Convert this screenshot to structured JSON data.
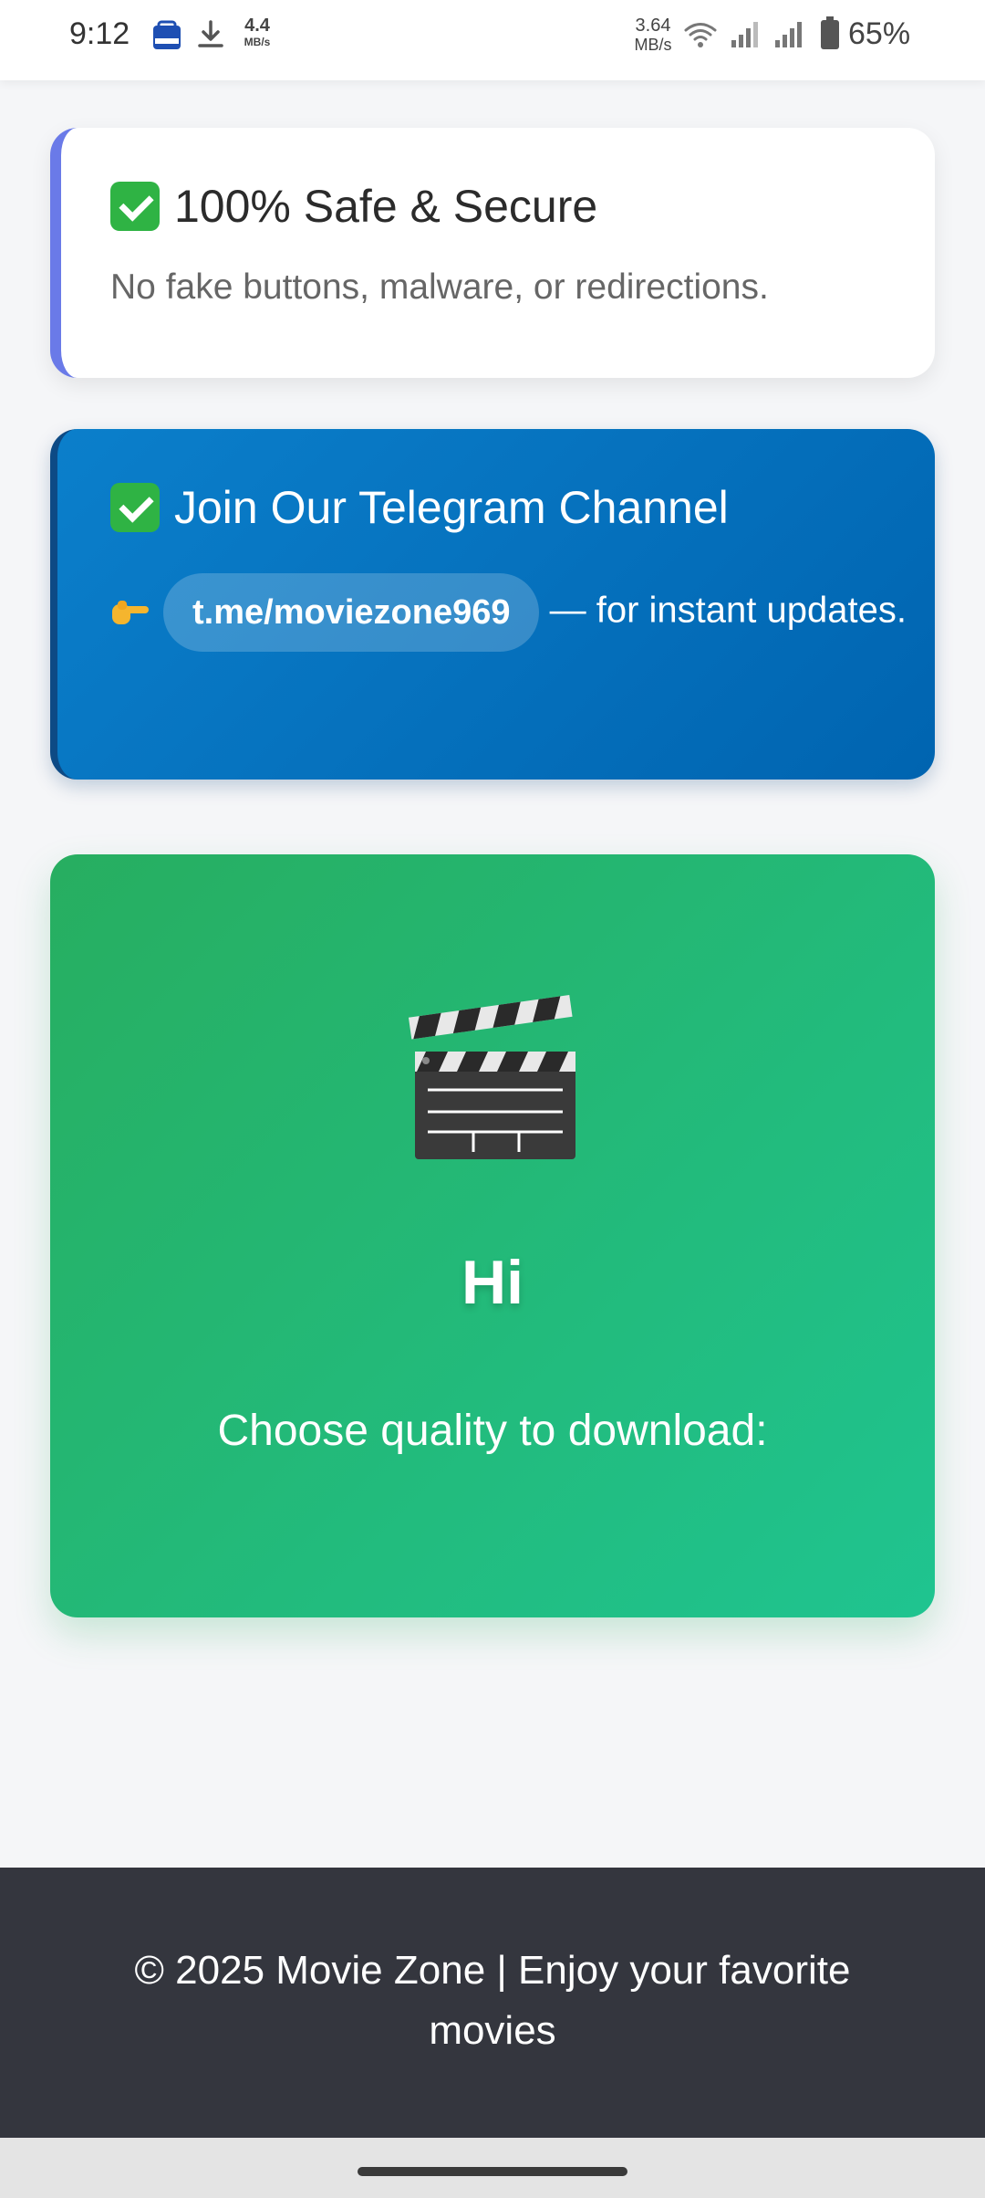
{
  "status_bar": {
    "time": "9:12",
    "speed_left_value": "4.4",
    "speed_left_unit": "MB/s",
    "speed_right_value": "3.64",
    "speed_right_unit": "MB/s",
    "battery": "65%"
  },
  "safe_card": {
    "title": "100% Safe & Secure",
    "description": "No fake buttons, malware, or redirections."
  },
  "telegram_card": {
    "title": "Join Our Telegram Channel",
    "link": "t.me/moviezone969",
    "suffix": " — for instant updates."
  },
  "hero": {
    "greeting": "Hi",
    "prompt": "Choose quality to download:"
  },
  "footer": {
    "text": "© 2025 Movie Zone | Enjoy your favorite movies"
  },
  "icons": {
    "check": "check-mark-icon",
    "hand": "pointing-hand-icon",
    "clapper": "clapper-board-icon"
  },
  "colors": {
    "safe_border": "#6a7ae8",
    "telegram_bg": "#0b7fcb",
    "hero_bg_start": "#27ae60",
    "hero_bg_end": "#1fc490",
    "footer_bg": "#34363e",
    "check": "#2fb344"
  }
}
